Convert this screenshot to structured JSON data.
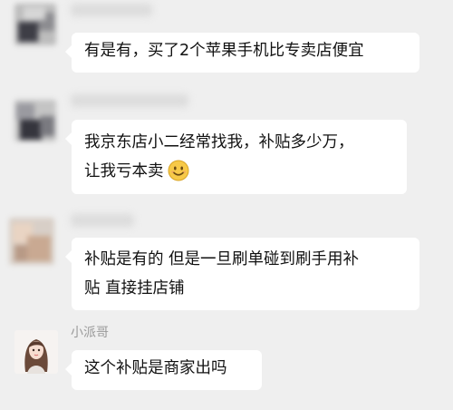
{
  "messages": [
    {
      "sender": "",
      "lines": [
        "有是有，买了2个苹果手机比专卖店便宜"
      ]
    },
    {
      "sender": "",
      "lines": [
        "我京东店小二经常找我，补贴多少万，",
        "让我亏本卖"
      ],
      "emoji": "smile-emoji"
    },
    {
      "sender": "",
      "lines": [
        "补贴是有的  但是一旦刷单碰到刷手用补",
        "贴 直接挂店铺"
      ]
    },
    {
      "sender": "小派哥",
      "lines": [
        "这个补贴是商家出吗"
      ]
    }
  ],
  "colors": {
    "background": "#efefef",
    "bubble": "#ffffff",
    "text": "#111111",
    "sender": "#9a9a9a",
    "emoji": "#f7c948"
  }
}
